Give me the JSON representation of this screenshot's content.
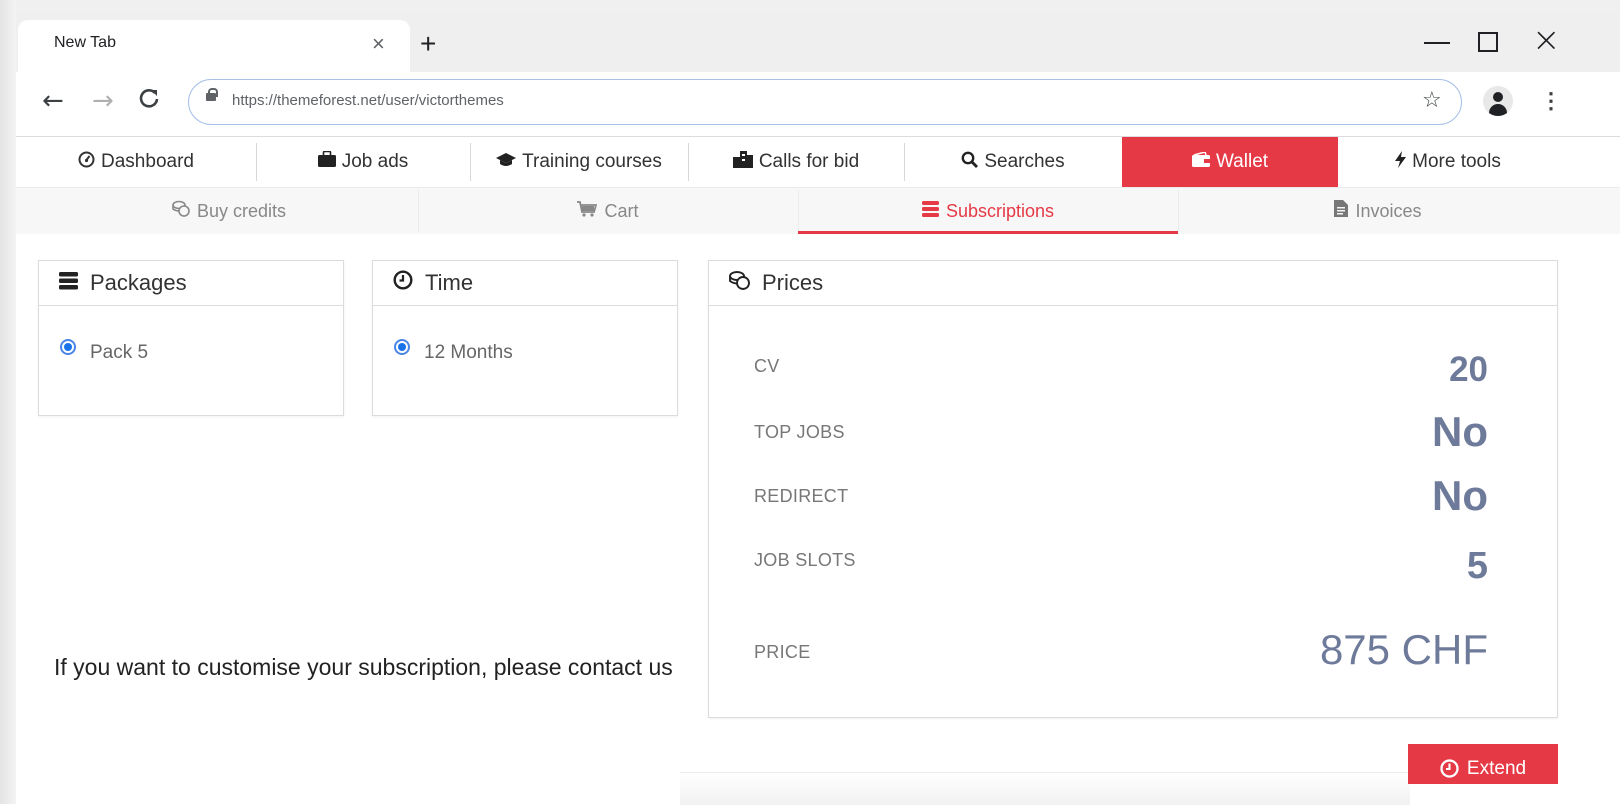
{
  "browser": {
    "tab_title": "New Tab",
    "tab_close": "×",
    "new_tab": "+",
    "url": "https://themeforest.net/user/victorthemes",
    "back": "←",
    "forward": "→",
    "reload": "C",
    "star": "☆",
    "menu": "⋮",
    "close": "×"
  },
  "topnav": {
    "items": [
      {
        "label": "Dashboard",
        "icon": "dashboard-icon"
      },
      {
        "label": "Job ads",
        "icon": "briefcase-icon"
      },
      {
        "label": "Training courses",
        "icon": "graduation-cap-icon"
      },
      {
        "label": "Calls for bid",
        "icon": "building-icon"
      },
      {
        "label": "Searches",
        "icon": "search-icon"
      },
      {
        "label": "Wallet",
        "icon": "wallet-icon",
        "active": true
      },
      {
        "label": "More tools",
        "icon": "bolt-icon"
      }
    ]
  },
  "subnav": {
    "items": [
      {
        "label": "Buy credits",
        "icon": "coins-icon"
      },
      {
        "label": "Cart",
        "icon": "cart-icon"
      },
      {
        "label": "Subscriptions",
        "icon": "stack-icon",
        "active": true
      },
      {
        "label": "Invoices",
        "icon": "invoice-icon"
      }
    ]
  },
  "packages": {
    "title": "Packages",
    "options": [
      {
        "label": "Pack 5",
        "selected": true
      }
    ]
  },
  "time": {
    "title": "Time",
    "options": [
      {
        "label": "12 Months",
        "selected": true
      }
    ]
  },
  "prices": {
    "title": "Prices",
    "rows": [
      {
        "label": "CV",
        "value": "20"
      },
      {
        "label": "TOP JOBS",
        "value": "No"
      },
      {
        "label": "REDIRECT",
        "value": "No"
      },
      {
        "label": "JOB SLOTS",
        "value": "5"
      },
      {
        "label": "PRICE",
        "value": "875 CHF"
      }
    ]
  },
  "custom_message": "If you want to customise your subscription, please contact us",
  "extend_button": "Extend",
  "colors": {
    "accent": "#e63946",
    "value_text": "#6d7a9a",
    "radio": "#1a73e8"
  }
}
